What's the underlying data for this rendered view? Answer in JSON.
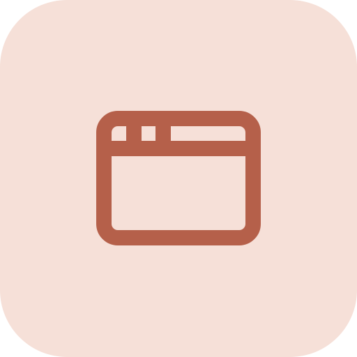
{
  "app_icon": {
    "icon": "browser-window-icon",
    "background_color": "#f6e0d8",
    "foreground_color": "#b5604a"
  }
}
